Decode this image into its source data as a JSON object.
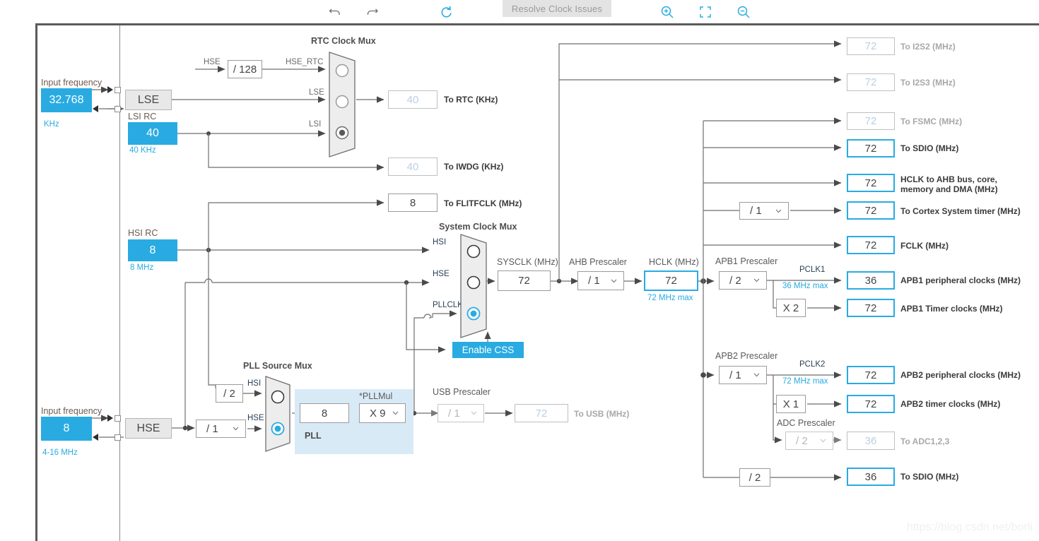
{
  "toolbar": {
    "undo_label": "undo-icon",
    "redo_label": "redo-icon",
    "reset_label": "reset-icon",
    "resolve_label": "Resolve Clock Issues",
    "zoom_in_label": "zoom-in-icon",
    "fit_label": "fit-screen-icon",
    "zoom_out_label": "zoom-out-icon"
  },
  "lse": {
    "input_frequency_label": "Input frequency",
    "value": "32.768",
    "unit": "KHz",
    "osc_label": "LSE"
  },
  "lsi": {
    "title": "LSI RC",
    "value": "40",
    "range": "40 KHz"
  },
  "hsi": {
    "title": "HSI RC",
    "value": "8",
    "range": "8 MHz"
  },
  "hse": {
    "input_frequency_label": "Input frequency",
    "value": "8",
    "range": "4-16 MHz",
    "osc_label": "HSE"
  },
  "rtc_mux": {
    "title": "RTC Clock Mux",
    "hse_label": "HSE",
    "div128": "/ 128",
    "hse_rtc_label": "HSE_RTC",
    "lse_label": "LSE",
    "lsi_label": "LSI",
    "selected_index": 2
  },
  "outputs_left": [
    {
      "name": "to-rtc",
      "value": "40",
      "label": "To RTC (KHz)",
      "state": "dim"
    },
    {
      "name": "to-iwdg",
      "value": "40",
      "label": "To IWDG (KHz)",
      "state": "dim"
    },
    {
      "name": "to-flitfclk",
      "value": "8",
      "label": "To FLITFCLK (MHz)",
      "state": "normal"
    }
  ],
  "system_clock_mux": {
    "title": "System Clock Mux",
    "inputs": [
      "HSI",
      "HSE",
      "PLLCLK"
    ],
    "selected_index": 2,
    "enable_css": "Enable CSS"
  },
  "sysclk": {
    "label": "SYSCLK (MHz)",
    "value": "72"
  },
  "ahb_prescaler": {
    "label": "AHB Prescaler",
    "value": "/ 1"
  },
  "hclk": {
    "label": "HCLK (MHz)",
    "value": "72",
    "max": "72 MHz max"
  },
  "pll_source_mux": {
    "title": "PLL Source Mux",
    "div2": "/ 2",
    "hsi_label": "HSI",
    "hse_div": "/ 1",
    "hse_label": "HSE",
    "selected_index": 1
  },
  "pll": {
    "tag": "PLL",
    "input_value": "8",
    "mul_label": "*PLLMul",
    "mul_value": "X 9"
  },
  "usb": {
    "prescaler_label": "USB Prescaler",
    "prescaler_value": "/ 1",
    "value": "72",
    "label": "To USB (MHz)"
  },
  "outputs_right": [
    {
      "name": "to-i2s2",
      "value": "72",
      "label": "To I2S2 (MHz)",
      "state": "dim"
    },
    {
      "name": "to-i2s3",
      "value": "72",
      "label": "To I2S3 (MHz)",
      "state": "dim"
    },
    {
      "name": "to-fsmc",
      "value": "72",
      "label": "To FSMC (MHz)",
      "state": "dim"
    },
    {
      "name": "to-sdio",
      "value": "72",
      "label": "To SDIO (MHz)",
      "state": "active"
    },
    {
      "name": "hclk-ahb",
      "value": "72",
      "label": "HCLK to AHB bus, core,\nmemory and DMA (MHz)",
      "state": "active"
    },
    {
      "name": "to-cortex",
      "value": "72",
      "label": "To Cortex System timer (MHz)",
      "state": "active"
    },
    {
      "name": "fclk",
      "value": "72",
      "label": "FCLK (MHz)",
      "state": "active"
    }
  ],
  "cortex_prescaler": {
    "value": "/ 1"
  },
  "apb1": {
    "prescaler_label": "APB1 Prescaler",
    "prescaler_value": "/ 2",
    "pclk_label": "PCLK1",
    "max": "36 MHz max",
    "mul": "X 2",
    "peripheral": {
      "value": "36",
      "label": "APB1 peripheral clocks (MHz)"
    },
    "timer": {
      "value": "72",
      "label": "APB1 Timer clocks (MHz)"
    }
  },
  "apb2": {
    "prescaler_label": "APB2 Prescaler",
    "prescaler_value": "/ 1",
    "pclk_label": "PCLK2",
    "max": "72 MHz max",
    "mul": "X 1",
    "peripheral": {
      "value": "72",
      "label": "APB2 peripheral clocks (MHz)"
    },
    "timer": {
      "value": "72",
      "label": "APB2 timer clocks (MHz)"
    },
    "adc_prescaler_label": "ADC Prescaler",
    "adc_prescaler_value": "/ 2",
    "adc": {
      "value": "36",
      "label": "To ADC1,2,3"
    }
  },
  "sdio_bottom": {
    "div": "/ 2",
    "value": "36",
    "label": "To SDIO (MHz)"
  },
  "watermark": "https://blog.csdn.net/borli",
  "colors": {
    "accent": "#29abe2",
    "wire": "#6e6e6e",
    "muxfill": "#ededed"
  }
}
